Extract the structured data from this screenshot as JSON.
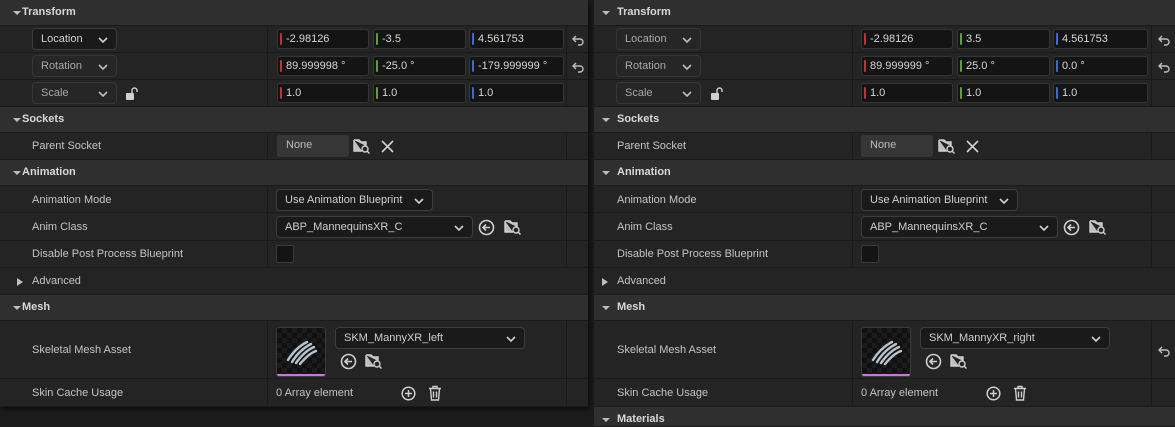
{
  "panels": [
    {
      "id": "left",
      "sections": {
        "transform": "Transform",
        "sockets": "Sockets",
        "animation": "Animation",
        "mesh": "Mesh"
      },
      "transform": {
        "location": {
          "mode": "Location",
          "x": "-2.98126",
          "y": "-3.5",
          "z": "4.561753"
        },
        "rotation": {
          "mode": "Rotation",
          "x": "89.999998 °",
          "y": "-25.0 °",
          "z": "-179.999999 °"
        },
        "scale": {
          "mode": "Scale",
          "x": "1.0",
          "y": "1.0",
          "z": "1.0"
        }
      },
      "sockets": {
        "parent_socket_label": "Parent Socket",
        "parent_socket_value": "None"
      },
      "animation": {
        "mode_label": "Animation Mode",
        "mode_value": "Use Animation Blueprint",
        "anim_class_label": "Anim Class",
        "anim_class_value": "ABP_MannequinsXR_C",
        "disable_pp_label": "Disable Post Process Blueprint",
        "advanced_label": "Advanced"
      },
      "mesh": {
        "skeletal_label": "Skeletal Mesh Asset",
        "skeletal_value": "SKM_MannyXR_left",
        "skin_cache_label": "Skin Cache Usage",
        "skin_cache_value": "0 Array element"
      }
    },
    {
      "id": "right",
      "sections": {
        "transform": "Transform",
        "sockets": "Sockets",
        "animation": "Animation",
        "mesh": "Mesh",
        "materials": "Materials"
      },
      "transform": {
        "location": {
          "mode": "Location",
          "x": "-2.98126",
          "y": "3.5",
          "z": "4.561753"
        },
        "rotation": {
          "mode": "Rotation",
          "x": "89.999999 °",
          "y": "25.0 °",
          "z": "0.0 °"
        },
        "scale": {
          "mode": "Scale",
          "x": "1.0",
          "y": "1.0",
          "z": "1.0"
        }
      },
      "sockets": {
        "parent_socket_label": "Parent Socket",
        "parent_socket_value": "None"
      },
      "animation": {
        "mode_label": "Animation Mode",
        "mode_value": "Use Animation Blueprint",
        "anim_class_label": "Anim Class",
        "anim_class_value": "ABP_MannequinsXR_C",
        "disable_pp_label": "Disable Post Process Blueprint",
        "advanced_label": "Advanced"
      },
      "mesh": {
        "skeletal_label": "Skeletal Mesh Asset",
        "skeletal_value": "SKM_MannyXR_right",
        "skin_cache_label": "Skin Cache Usage",
        "skin_cache_value": "0 Array element"
      }
    }
  ],
  "colors": {
    "x_axis": "#c23232",
    "y_axis": "#5aa234",
    "z_axis": "#2f6fd6",
    "thumbnail_accent": "#c878d8"
  }
}
